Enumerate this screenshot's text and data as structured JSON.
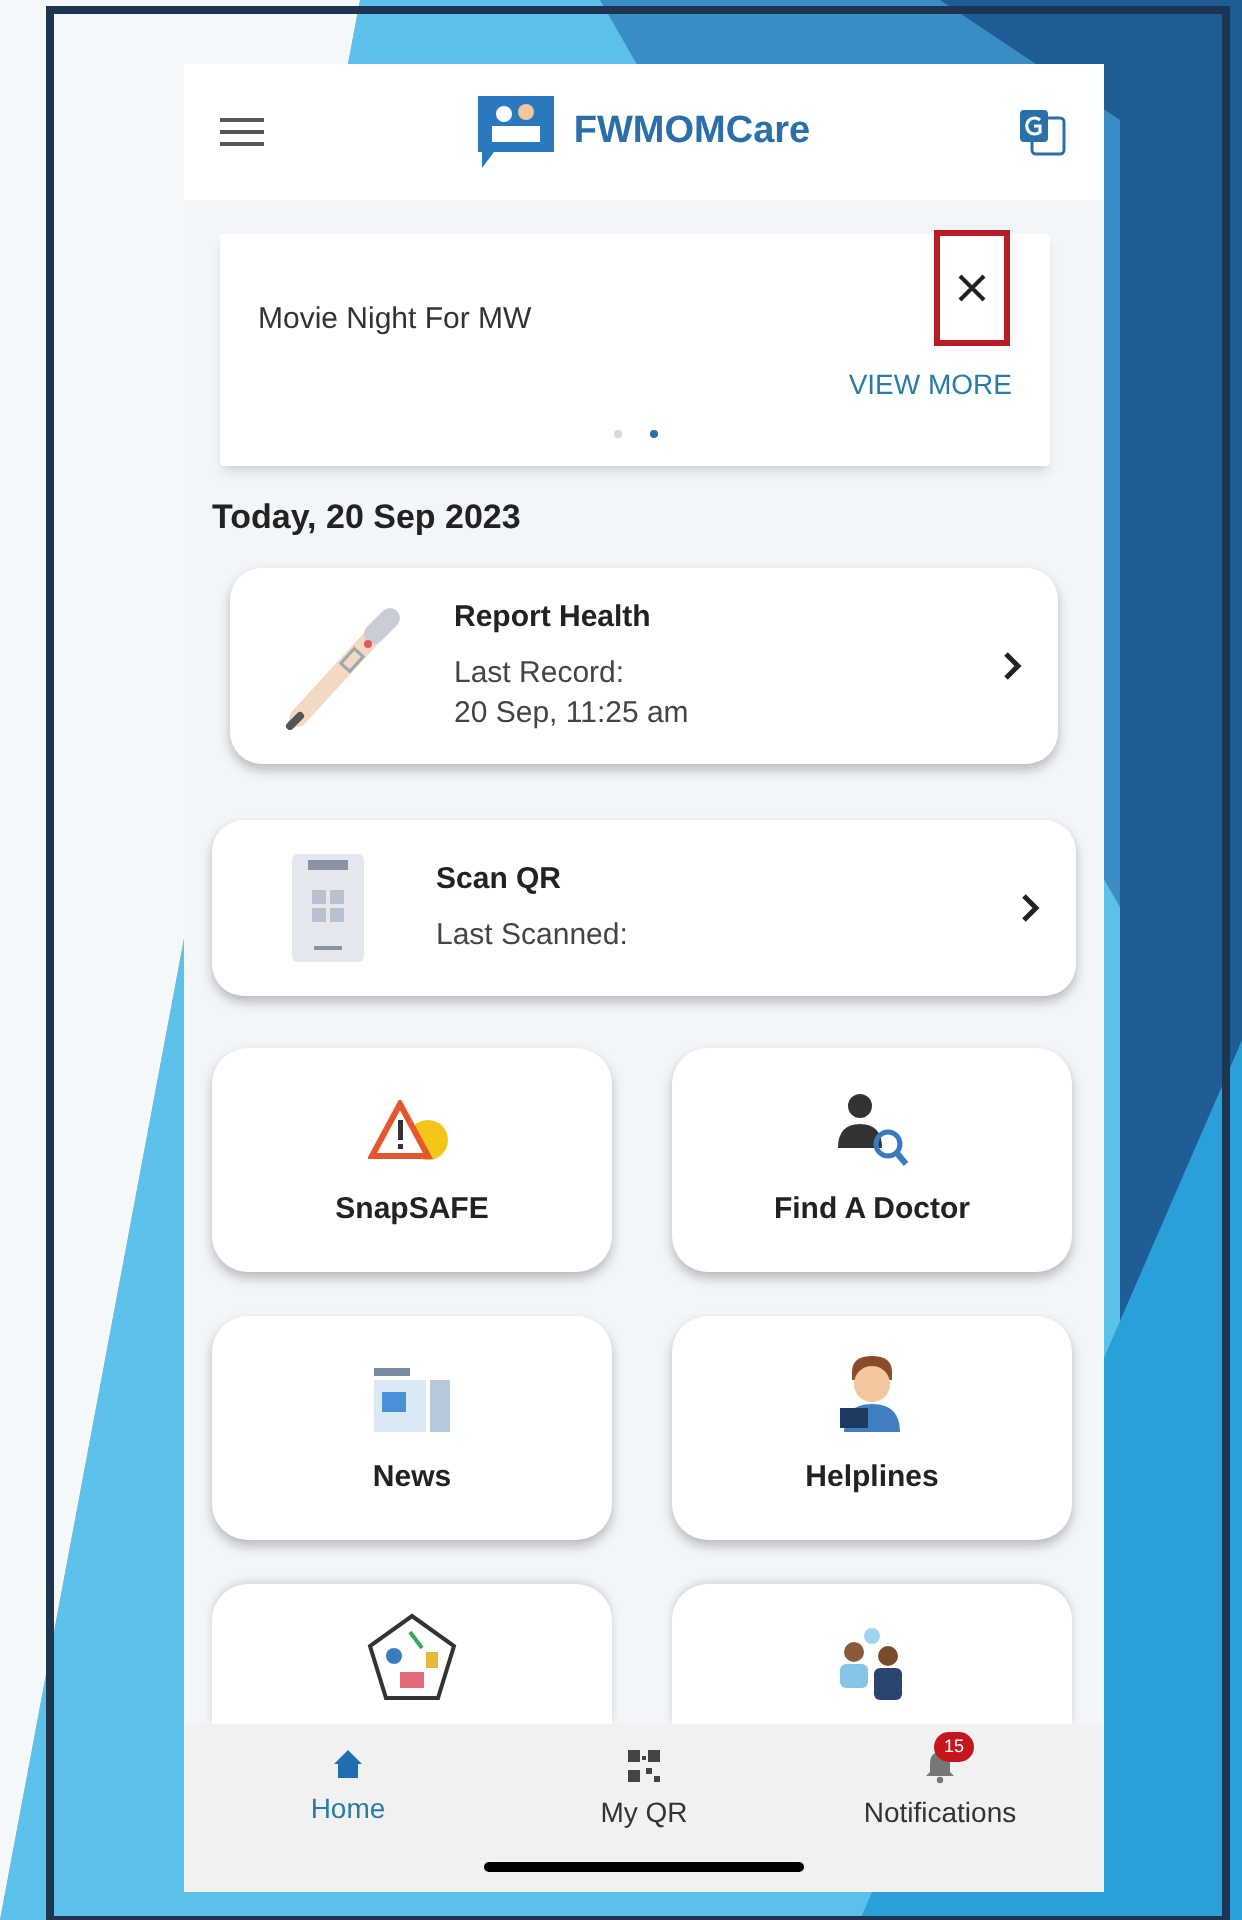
{
  "header": {
    "title": "FWMOMCare"
  },
  "banner": {
    "text": "Movie Night For MW",
    "link": "VIEW MORE",
    "dots": [
      {
        "selected": false
      },
      {
        "selected": true
      }
    ]
  },
  "date": "Today, 20 Sep 2023",
  "records": [
    {
      "kind": "thermometer",
      "title": "Report Health",
      "lines": [
        "Last Record:",
        "20 Sep, 11:25 am"
      ]
    },
    {
      "kind": "scanner",
      "title": "Scan QR",
      "lines": [
        "Last Scanned:"
      ]
    }
  ],
  "tiles": [
    {
      "kind": "warning",
      "label": "SnapSAFE"
    },
    {
      "kind": "doctor",
      "label": "Find A Doctor"
    },
    {
      "kind": "news",
      "label": "News"
    },
    {
      "kind": "helpline",
      "label": "Helplines"
    },
    {
      "kind": "pentagon"
    },
    {
      "kind": "people"
    }
  ],
  "nav": [
    {
      "kind": "home",
      "label": "Home",
      "selected": true
    },
    {
      "kind": "qr",
      "label": "My QR",
      "selected": false
    },
    {
      "kind": "bell",
      "label": "Notifications",
      "selected": false,
      "badge": "15"
    }
  ]
}
